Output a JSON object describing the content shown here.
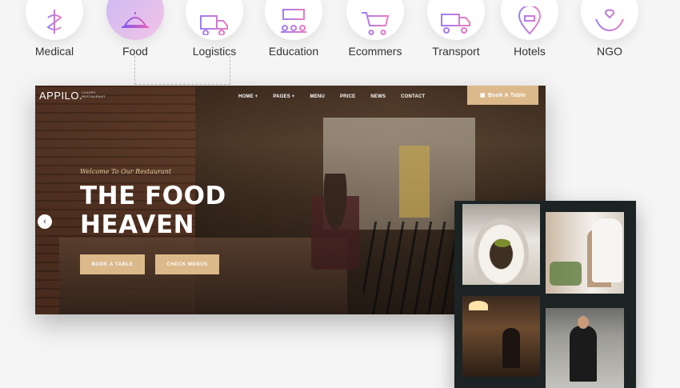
{
  "categories": [
    {
      "label": "Medical",
      "icon": "medical-caduceus-icon"
    },
    {
      "label": "Food",
      "icon": "food-cloche-icon",
      "active": true
    },
    {
      "label": "Logistics",
      "icon": "logistics-truck-icon"
    },
    {
      "label": "Education",
      "icon": "education-classroom-icon"
    },
    {
      "label": "Ecommers",
      "icon": "ecommerce-cart-icon"
    },
    {
      "label": "Transport",
      "icon": "transport-truck-icon"
    },
    {
      "label": "Hotels",
      "icon": "hotel-location-icon"
    },
    {
      "label": "NGO",
      "icon": "ngo-hands-icon"
    }
  ],
  "website": {
    "logo": "APPILO.",
    "logo_sub_1": "LUXURY",
    "logo_sub_2": "RESTAURANT",
    "nav": [
      "HOME +",
      "PAGES +",
      "MENU",
      "PRICE",
      "NEWS",
      "CONTACT"
    ],
    "book_top": "Book A Table",
    "welcome": "Welcome To Our Restaurant",
    "hero_line1": "THE FOOD",
    "hero_line2": "HEAVEN",
    "btn_book": "BOOK A TABLE",
    "btn_menu": "CHECK MENUS",
    "arrow": "‹"
  },
  "colors": {
    "accent": "#dcb98a",
    "gallery_bg": "#1c2324",
    "icon_gradient_start": "#9b7df2",
    "icon_gradient_end": "#f07ac2"
  }
}
